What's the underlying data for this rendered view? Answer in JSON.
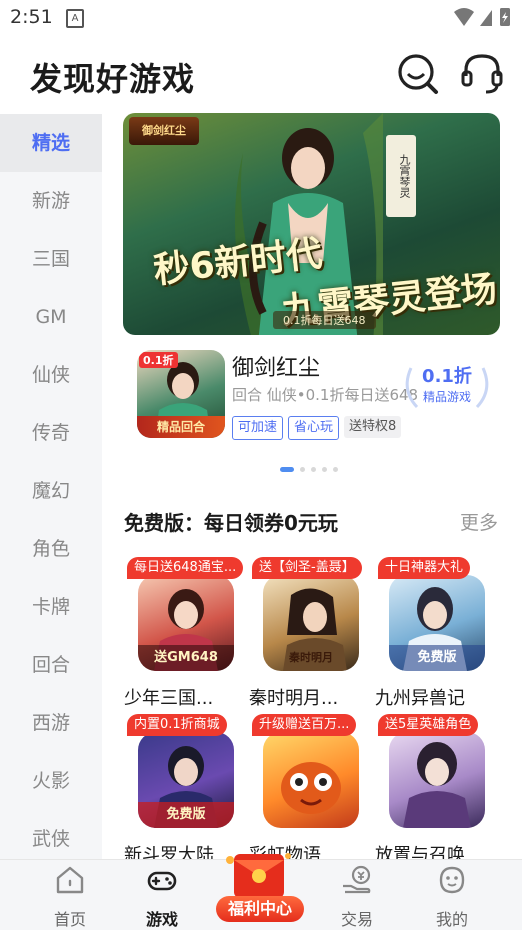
{
  "status": {
    "time": "2:51",
    "notif_letter": "A"
  },
  "header": {
    "title": "发现好游戏"
  },
  "sidebar": {
    "items": [
      {
        "label": "精选",
        "active": true
      },
      {
        "label": "新游"
      },
      {
        "label": "三国"
      },
      {
        "label": "GM"
      },
      {
        "label": "仙侠"
      },
      {
        "label": "传奇"
      },
      {
        "label": "魔幻"
      },
      {
        "label": "角色"
      },
      {
        "label": "卡牌"
      },
      {
        "label": "回合"
      },
      {
        "label": "西游"
      },
      {
        "label": "火影"
      },
      {
        "label": "武侠"
      }
    ]
  },
  "banner": {
    "logo": "御剑红尘",
    "scroll_text": "九霄琴灵",
    "slogan1": "秒6新时代",
    "slogan2": "九霄琴灵登场",
    "subline": "0.1折每日送648"
  },
  "featured": {
    "name": "御剑红尘",
    "desc": "回合 仙侠•0.1折每日送648",
    "icon_tag": "0.1折",
    "icon_foot": "精品回合",
    "chips": [
      "可加速",
      "省心玩",
      "送特权8"
    ],
    "discount": "0.1折",
    "discount_sub": "精品游戏"
  },
  "carousel": {
    "count": 5,
    "active": 0
  },
  "section": {
    "title": "免费版：每日领券0元玩",
    "more": "更多"
  },
  "games": [
    {
      "badge": "每日送648通宝...",
      "name": "少年三国...",
      "overlay": "送GM648"
    },
    {
      "badge": "送【剑圣-盖聂】",
      "name": "秦时明月...",
      "overlay": "秦时明月"
    },
    {
      "badge": "十日神器大礼",
      "name": "九州异兽记",
      "overlay": "免费版"
    },
    {
      "badge": "内置0.1折商城",
      "name": "新斗罗大陆",
      "overlay": "免费版"
    },
    {
      "badge": "升级赠送百万...",
      "name": "彩虹物语",
      "overlay": ""
    },
    {
      "badge": "送5星英雄角色",
      "name": "放置与召唤",
      "overlay": ""
    }
  ],
  "tabbar": {
    "home": "首页",
    "games": "游戏",
    "welfare": "福利中心",
    "trade": "交易",
    "mine": "我的"
  },
  "colors": {
    "accent": "#4f6ef2",
    "badge_red": "#ef3a2e"
  }
}
